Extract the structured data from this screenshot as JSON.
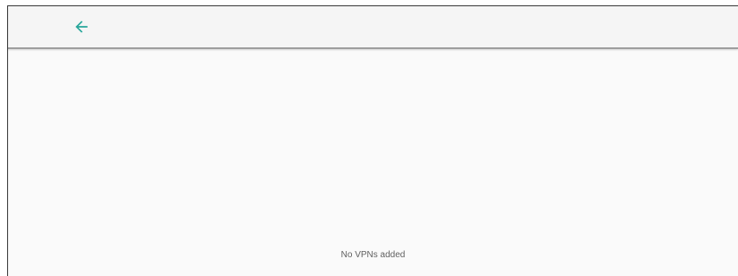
{
  "app_bar": {
    "back_icon": "arrow-back-icon",
    "accent_color": "#26a69a"
  },
  "content": {
    "empty_message": "No VPNs added"
  }
}
